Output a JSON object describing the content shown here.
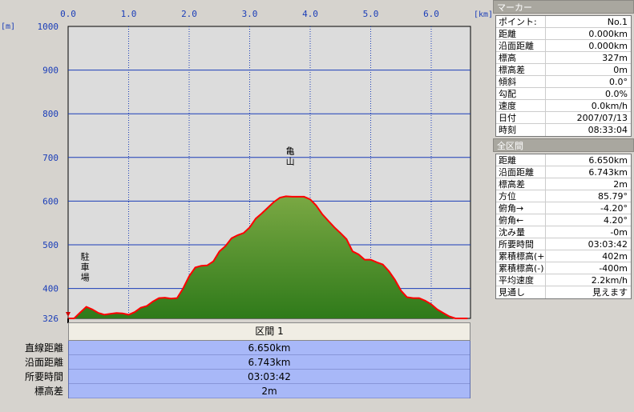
{
  "chart_data": {
    "type": "area",
    "x_unit": "[km]",
    "y_unit": "[m]",
    "x_ticks": [
      "0.0",
      "1.0",
      "2.0",
      "3.0",
      "4.0",
      "5.0",
      "6.0"
    ],
    "y_ticks": [
      "326",
      "400",
      "500",
      "600",
      "700",
      "800",
      "900",
      "1000"
    ],
    "xlim": [
      0,
      6.6
    ],
    "ylim": [
      326,
      1000
    ],
    "grid": true,
    "x": [
      0.0,
      0.1,
      0.2,
      0.3,
      0.4,
      0.5,
      0.6,
      0.7,
      0.8,
      0.9,
      1.0,
      1.1,
      1.2,
      1.3,
      1.4,
      1.5,
      1.6,
      1.7,
      1.8,
      1.9,
      2.0,
      2.1,
      2.2,
      2.3,
      2.4,
      2.5,
      2.6,
      2.7,
      2.8,
      2.9,
      3.0,
      3.1,
      3.2,
      3.3,
      3.4,
      3.5,
      3.6,
      3.7,
      3.8,
      3.9,
      4.0,
      4.1,
      4.2,
      4.3,
      4.4,
      4.5,
      4.6,
      4.7,
      4.8,
      4.9,
      5.0,
      5.1,
      5.2,
      5.3,
      5.4,
      5.5,
      5.6,
      5.7,
      5.8,
      5.9,
      6.0,
      6.1,
      6.2,
      6.3,
      6.4,
      6.5,
      6.6
    ],
    "y": [
      327,
      330,
      345,
      358,
      352,
      344,
      340,
      342,
      344,
      343,
      340,
      346,
      356,
      360,
      370,
      378,
      379,
      377,
      378,
      400,
      428,
      448,
      452,
      453,
      462,
      485,
      497,
      515,
      522,
      527,
      540,
      560,
      572,
      585,
      598,
      608,
      611,
      610,
      610,
      610,
      604,
      590,
      570,
      555,
      540,
      527,
      513,
      485,
      478,
      466,
      466,
      460,
      455,
      440,
      420,
      395,
      380,
      378,
      378,
      372,
      364,
      352,
      344,
      336,
      330,
      327,
      327
    ],
    "annotations": [
      {
        "text": "亀山",
        "x": 3.67,
        "y": 660
      },
      {
        "text": "駐車場",
        "x": 0.28,
        "y": 395
      }
    ]
  },
  "section": {
    "title": "区間 1",
    "labels": [
      "直線距離",
      "沿面距離",
      "所要時間",
      "標高差"
    ],
    "values": [
      "6.650km",
      "6.743km",
      "03:03:42",
      "2m"
    ]
  },
  "marker_panel": {
    "title": "マーカー",
    "rows": [
      {
        "key": "ポイント:",
        "val": "No.1"
      },
      {
        "key": "距離",
        "val": "0.000km"
      },
      {
        "key": "沿面距離",
        "val": "0.000km"
      },
      {
        "key": "標高",
        "val": "327m"
      },
      {
        "key": "標高差",
        "val": "0m"
      },
      {
        "key": "傾斜",
        "val": "0.0°"
      },
      {
        "key": "勾配",
        "val": "0.0%"
      },
      {
        "key": "速度",
        "val": "0.0km/h"
      },
      {
        "key": "日付",
        "val": "2007/07/13"
      },
      {
        "key": "時刻",
        "val": "08:33:04"
      }
    ]
  },
  "total_panel": {
    "title": "全区間",
    "rows": [
      {
        "key": "距離",
        "val": "6.650km"
      },
      {
        "key": "沿面距離",
        "val": "6.743km"
      },
      {
        "key": "標高差",
        "val": "2m"
      },
      {
        "key": "方位",
        "val": "85.79°"
      },
      {
        "key": "俯角→",
        "val": "-4.20°"
      },
      {
        "key": "俯角←",
        "val": "4.20°"
      },
      {
        "key": "沈み量",
        "val": "-0m"
      },
      {
        "key": "所要時間",
        "val": "03:03:42"
      },
      {
        "key": "累積標高(+)",
        "val": "402m"
      },
      {
        "key": "累積標高(-)",
        "val": "-400m"
      },
      {
        "key": "平均速度",
        "val": "2.2km/h"
      },
      {
        "key": "見通し",
        "val": "見えます"
      }
    ]
  },
  "colors": {
    "plot_bg": "#dcdcdc",
    "fill_top": "#7aa843",
    "fill_bottom": "#2f7a1a",
    "profile_line": "#ff0000",
    "grid": "#1a3db8"
  }
}
